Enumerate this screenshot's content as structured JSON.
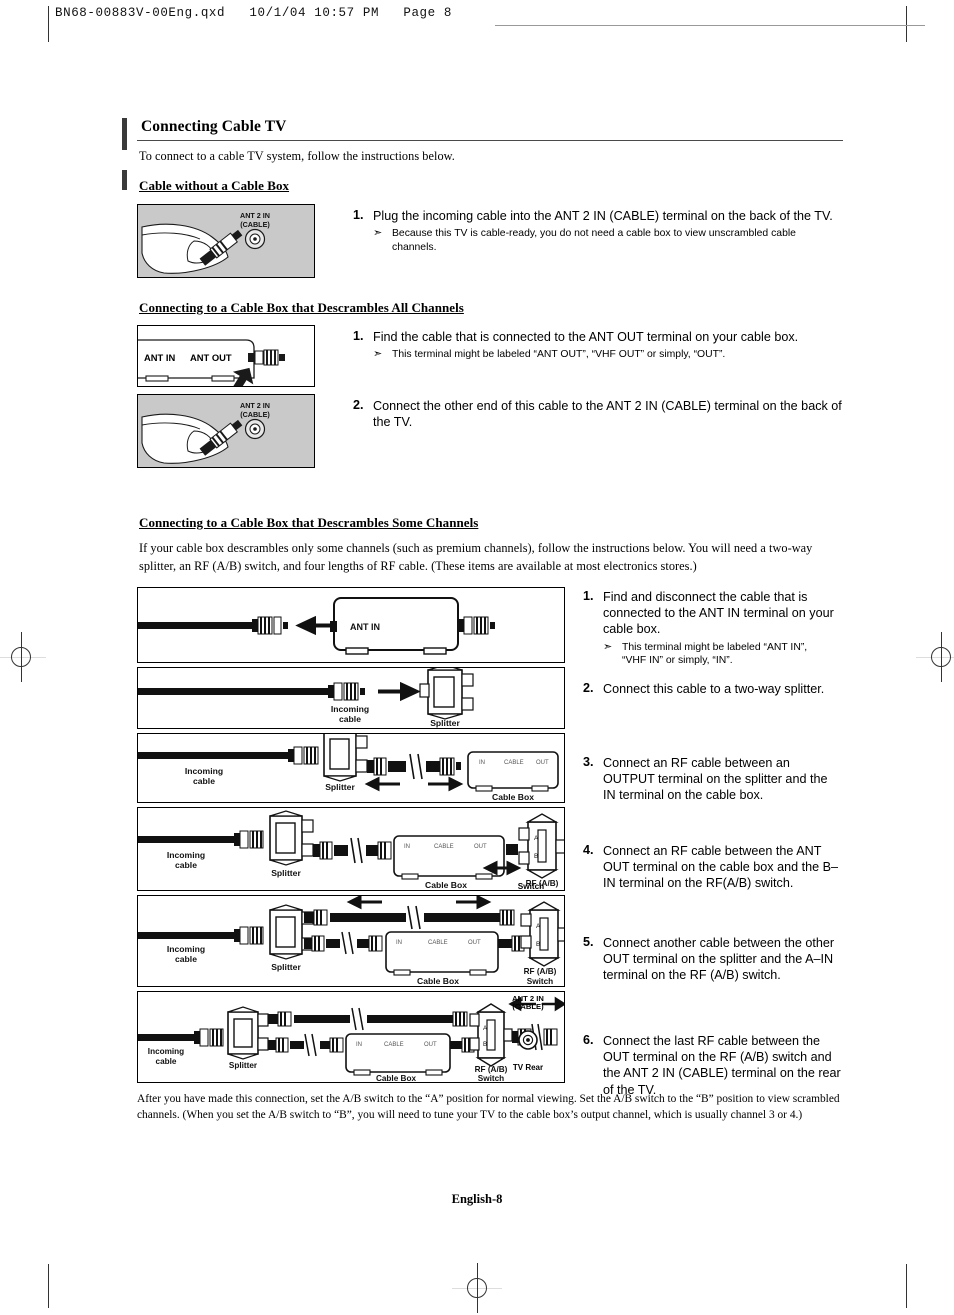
{
  "print_header": {
    "filename_line": "BN68-00883V-00Eng.qxd   10/1/04 10:57 PM   Page 8"
  },
  "section": {
    "title": "Connecting Cable TV",
    "intro": "To connect to a cable TV system, follow the instructions below."
  },
  "part1": {
    "heading": "Cable without a Cable Box",
    "illustration": {
      "label_line1": "ANT 2 IN",
      "label_line2": "(CABLE)",
      "name": "hand-plugging-cable-into-tv"
    },
    "steps": [
      {
        "num": "1.",
        "text": "Plug the incoming cable into the ANT 2 IN (CABLE) terminal on the back of the TV.",
        "note": "Because this TV is cable-ready, you do not need a cable box to view unscrambled cable channels."
      }
    ]
  },
  "part2": {
    "heading": "Connecting to a Cable Box that Descrambles All Channels",
    "illustration_a": {
      "label_ant_in": "ANT IN",
      "label_ant_out": "ANT OUT",
      "name": "cable-box-ant-out-detail"
    },
    "illustration_b": {
      "label_line1": "ANT 2 IN",
      "label_line2": "(CABLE)",
      "name": "hand-plugging-cable-into-tv"
    },
    "steps": [
      {
        "num": "1.",
        "text": "Find the cable that is connected to the ANT OUT terminal on your cable box.",
        "note": "This terminal might be labeled “ANT OUT”, “VHF OUT” or simply, “OUT”."
      },
      {
        "num": "2.",
        "text": "Connect the other end of this cable to the ANT 2 IN (CABLE)  terminal on the back of the TV.",
        "note": ""
      }
    ]
  },
  "part3": {
    "heading": "Connecting to a Cable Box that Descrambles Some Channels",
    "intro": "If your cable box descrambles only some channels (such as premium channels), follow the instructions below. You will need a two-way splitter, an RF (A/B) switch, and four lengths of RF cable. (These items are available at most electronics stores.)",
    "steps": [
      {
        "num": "1.",
        "text": "Find and disconnect the cable that is connected to the ANT IN terminal on your cable box.",
        "note_line1": "This terminal might be labeled “ANT IN”,",
        "note_line2": "“VHF IN” or simply, “IN”."
      },
      {
        "num": "2.",
        "text": "Connect this cable to a two-way splitter.",
        "note_line1": "",
        "note_line2": ""
      },
      {
        "num": "3.",
        "text": "Connect an RF cable between an OUTPUT terminal on the splitter and the IN terminal on the cable box.",
        "note_line1": "",
        "note_line2": ""
      },
      {
        "num": "4.",
        "text": "Connect an RF cable between the ANT OUT terminal on the cable box and the B–IN terminal on the RF(A/B) switch.",
        "note_line1": "",
        "note_line2": ""
      },
      {
        "num": "5.",
        "text": "Connect another cable between the other OUT terminal on the splitter and the A–IN terminal on the RF (A/B) switch.",
        "note_line1": "",
        "note_line2": ""
      },
      {
        "num": "6.",
        "text": "Connect the last RF cable between the OUT terminal on the RF (A/B) switch and the ANT 2 IN (CABLE) terminal on the rear of the TV.",
        "note_line1": "",
        "note_line2": ""
      }
    ],
    "diagram_labels": {
      "ant_in": "ANT IN",
      "incoming_cable_line1": "Incoming",
      "incoming_cable_line2": "cable",
      "splitter": "Splitter",
      "cable_box": "Cable Box",
      "cable_box_in": "IN",
      "cable_box_center": "CABLE",
      "cable_box_out": "OUT",
      "rf_switch_line1": "RF (A/B)",
      "rf_switch_line2": "Switch",
      "rf_switch_a": "A",
      "rf_switch_b": "B",
      "ant2in_line1": "ANT 2 IN",
      "ant2in_line2": "(CABLE)",
      "tv_rear": "TV Rear"
    },
    "footnote": "After you have made this connection, set the A/B switch to the “A” position for normal viewing. Set the A/B switch to the “B” position to view scrambled channels. (When you set the A/B switch to “B”, you will need to tune your TV to the cable box’s output channel, which is usually channel 3 or 4.)"
  },
  "footer": {
    "page_label": "English-8"
  },
  "colors": {
    "illustration_bg": "#c9c9c9",
    "rule": "#4a4a4a",
    "accent_bar": "#3a3a3a"
  }
}
